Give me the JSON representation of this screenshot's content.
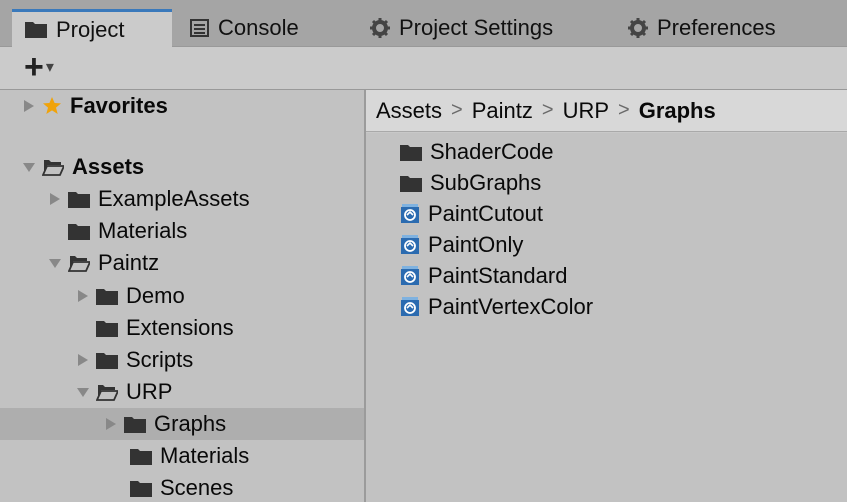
{
  "tabs": [
    {
      "label": "Project",
      "icon": "folder-icon",
      "active": true
    },
    {
      "label": "Console",
      "icon": "console-icon",
      "active": false
    },
    {
      "label": "Project Settings",
      "icon": "gear-icon",
      "active": false
    },
    {
      "label": "Preferences",
      "icon": "gear-icon",
      "active": false
    }
  ],
  "toolbar": {
    "create_label": "+",
    "create_dropdown": "▾"
  },
  "tree": {
    "favorites": "Favorites",
    "assets": "Assets",
    "items": [
      {
        "label": "ExampleAssets"
      },
      {
        "label": "Materials"
      },
      {
        "label": "Paintz"
      },
      {
        "label": "Demo"
      },
      {
        "label": "Extensions"
      },
      {
        "label": "Scripts"
      },
      {
        "label": "URP"
      },
      {
        "label": "Graphs"
      },
      {
        "label": "Materials"
      },
      {
        "label": "Scenes"
      }
    ]
  },
  "breadcrumb": [
    "Assets",
    "Paintz",
    "URP",
    "Graphs"
  ],
  "breadcrumb_sep": ">",
  "assets": [
    {
      "label": "ShaderCode",
      "icon": "folder-icon"
    },
    {
      "label": "SubGraphs",
      "icon": "folder-icon"
    },
    {
      "label": "PaintCutout",
      "icon": "shader-graph-icon"
    },
    {
      "label": "PaintOnly",
      "icon": "shader-graph-icon"
    },
    {
      "label": "PaintStandard",
      "icon": "shader-graph-icon"
    },
    {
      "label": "PaintVertexColor",
      "icon": "shader-graph-icon"
    }
  ],
  "colors": {
    "accent": "#3a79bb",
    "folder": "#3b3b3b",
    "star": "#f0a30a",
    "shader": "#2b6bb0"
  }
}
